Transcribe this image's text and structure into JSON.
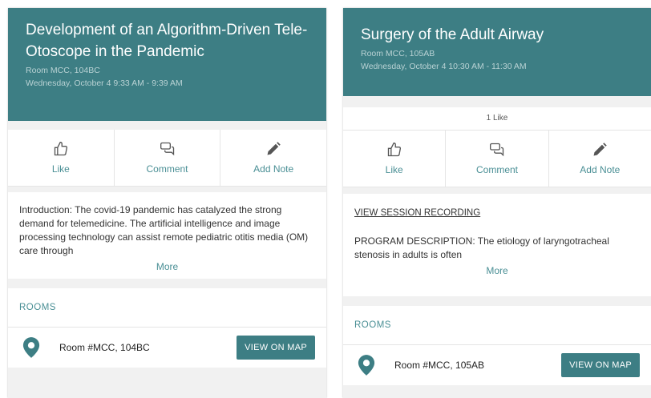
{
  "sessions": [
    {
      "title": "Development of an Algorithm-Driven Tele-Otoscope in the Pandemic",
      "room": "Room MCC, 104BC",
      "time": "Wednesday, October 4 9:33 AM - 9:39 AM",
      "likes": "",
      "actions": {
        "like": "Like",
        "comment": "Comment",
        "note": "Add Note"
      },
      "recording": "",
      "description": "Introduction: The covid-19 pandemic has catalyzed the strong demand for telemedicine. The artificial intelligence and image processing technology can assist remote pediatric otitis media (OM) care through",
      "more": "More",
      "rooms_heading": "ROOMS",
      "room_label": "Room #MCC, 104BC",
      "map_button": "VIEW ON MAP"
    },
    {
      "title": "Surgery of the Adult Airway",
      "room": "Room MCC, 105AB",
      "time": "Wednesday, October 4 10:30 AM - 11:30 AM",
      "likes": "1 Like",
      "actions": {
        "like": "Like",
        "comment": "Comment",
        "note": "Add Note"
      },
      "recording": "VIEW SESSION RECORDING",
      "description": "PROGRAM DESCRIPTION: The etiology of laryngotracheal stenosis in adults is often",
      "more": "More",
      "rooms_heading": "ROOMS",
      "room_label": "Room #MCC, 105AB",
      "map_button": "VIEW ON MAP"
    }
  ],
  "colors": {
    "header": "#3d7e84",
    "accent": "#4a8f95",
    "background": "#f1f1f1"
  },
  "icons": {
    "like": "thumbs-up-icon",
    "comment": "comment-icon",
    "note": "pencil-icon",
    "location": "map-pin-icon"
  }
}
